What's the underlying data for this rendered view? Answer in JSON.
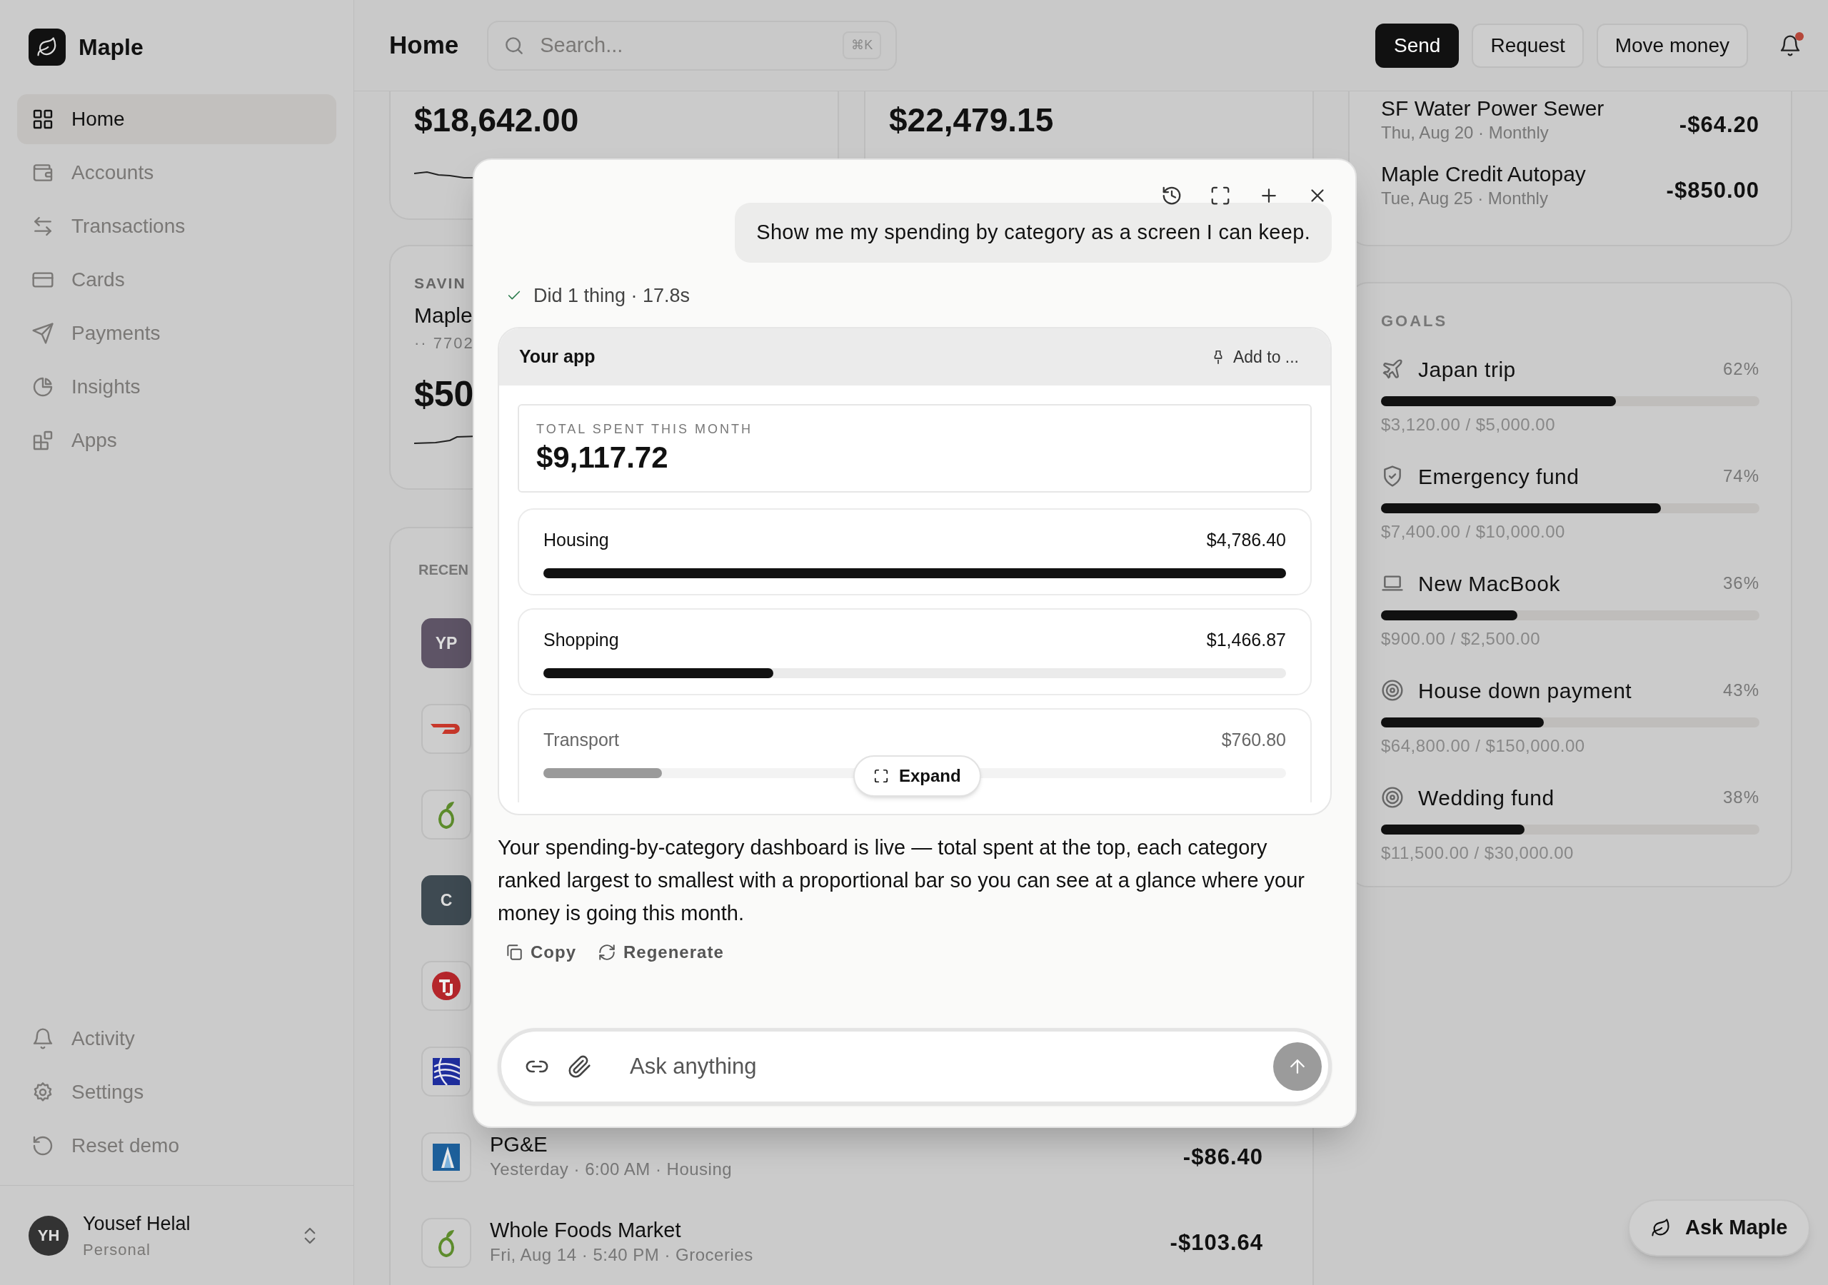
{
  "sidebar": {
    "brand": "Maple",
    "items": [
      {
        "label": "Home",
        "selected": true
      },
      {
        "label": "Accounts",
        "selected": false
      },
      {
        "label": "Transactions",
        "selected": false
      },
      {
        "label": "Cards",
        "selected": false
      },
      {
        "label": "Payments",
        "selected": false
      },
      {
        "label": "Insights",
        "selected": false
      },
      {
        "label": "Apps",
        "selected": false
      }
    ],
    "footer_items": [
      {
        "label": "Activity"
      },
      {
        "label": "Settings"
      },
      {
        "label": "Reset demo"
      }
    ],
    "user": {
      "initials": "YH",
      "name": "Yousef Helal",
      "subtitle": "Personal"
    }
  },
  "header": {
    "title": "Home",
    "search": {
      "placeholder": "Search...",
      "shortcut": "⌘K"
    },
    "buttons": [
      {
        "label": "Send",
        "kind": "primary"
      },
      {
        "label": "Request",
        "kind": "secondary"
      },
      {
        "label": "Move money",
        "kind": "secondary"
      }
    ],
    "notifications": {
      "unread": true
    }
  },
  "balance_cards": [
    {
      "amount": "$18,642.00",
      "sparkline": true
    },
    {
      "amount": "$22,479.15",
      "sparkline": false
    }
  ],
  "savings_card": {
    "label": "SAVIN",
    "name": "Maple",
    "account": "·· 7702",
    "amount": "$50"
  },
  "recent": {
    "title": "RECEN",
    "rows": [
      {
        "avatar": {
          "kind": "initials",
          "text": "YP",
          "color": "#5e5466"
        }
      },
      {
        "avatar": {
          "kind": "swoosh"
        }
      },
      {
        "avatar": {
          "kind": "sprout"
        }
      },
      {
        "avatar": {
          "kind": "initials",
          "text": "C",
          "color": "#3e4a52"
        }
      },
      {
        "avatar": {
          "kind": "emblem"
        }
      },
      {
        "avatar": {
          "kind": "globe"
        }
      },
      {
        "avatar": {
          "kind": "flag"
        },
        "name": "PG&E",
        "detail": "Yesterday · 6:00 AM · Housing",
        "amount": "-$86.40"
      },
      {
        "avatar": {
          "kind": "sprout"
        },
        "name": "Whole Foods Market",
        "detail": "Fri, Aug 14 · 5:40 PM · Groceries",
        "amount": "-$103.64"
      }
    ]
  },
  "upcoming": {
    "rows": [
      {
        "name": "SF Water Power Sewer",
        "detail": "Thu, Aug 20 · Monthly",
        "amount": "-$64.20"
      },
      {
        "name": "Maple Credit Autopay",
        "detail": "Tue, Aug 25 · Monthly",
        "amount": "-$850.00"
      }
    ]
  },
  "goals": {
    "title": "GOALS",
    "items": [
      {
        "kind": "plane",
        "name": "Japan trip",
        "percent": "62%",
        "level": 0.62,
        "amounts": "$3,120.00 / $5,000.00"
      },
      {
        "kind": "shield",
        "name": "Emergency fund",
        "percent": "74%",
        "level": 0.74,
        "amounts": "$7,400.00 / $10,000.00"
      },
      {
        "kind": "laptop",
        "name": "New MacBook",
        "percent": "36%",
        "level": 0.36,
        "amounts": "$900.00 / $2,500.00"
      },
      {
        "kind": "target",
        "name": "House down payment",
        "percent": "43%",
        "level": 0.43,
        "amounts": "$64,800.00 / $150,000.00"
      },
      {
        "kind": "target",
        "name": "Wedding fund",
        "percent": "38%",
        "level": 0.38,
        "amounts": "$11,500.00 / $30,000.00"
      }
    ]
  },
  "ask_button": {
    "label": "Ask Maple"
  },
  "assistant": {
    "user_message": "Show me my spending by category as a screen I can keep.",
    "status": "Did 1 thing · 17.8s",
    "app": {
      "title": "Your app",
      "add_label": "Add to ...",
      "total": {
        "label": "TOTAL SPENT THIS MONTH",
        "amount": "$9,117.72"
      },
      "categories": [
        {
          "name": "Housing",
          "amount": "$4,786.40",
          "level": 1.0
        },
        {
          "name": "Shopping",
          "amount": "$1,466.87",
          "level": 0.31
        },
        {
          "name": "Transport",
          "amount": "$760.80",
          "level": 0.16
        }
      ],
      "expand_label": "Expand"
    },
    "reply": "Your spending-by-category dashboard is live — total spent at the top, each category ranked largest to smallest with a proportional bar so you can see at a glance where your money is going this month.",
    "actions": [
      "Copy",
      "Regenerate"
    ],
    "input": {
      "placeholder": "Ask anything"
    }
  }
}
